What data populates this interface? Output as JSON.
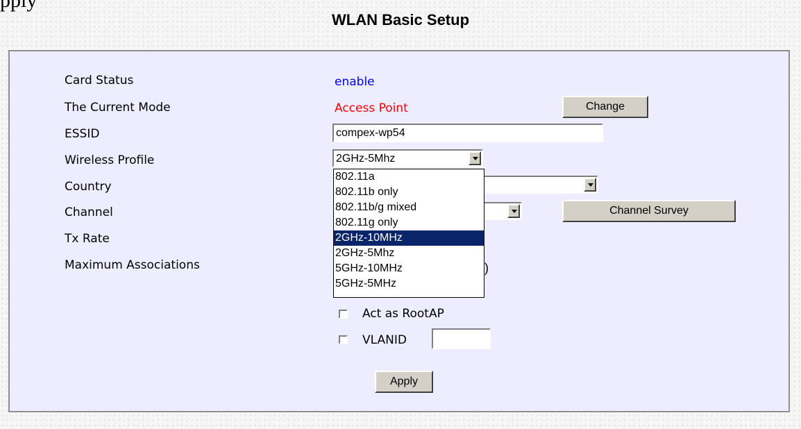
{
  "top_fragment": "pply",
  "page_title": "WLAN Basic Setup",
  "colors": {
    "panel_bg": "#ededff",
    "enable_text": "#0000ff",
    "mode_text": "#ff0000",
    "selected_bg": "#0a246a"
  },
  "fields": {
    "card_status_label": "Card Status",
    "card_status_value": "enable",
    "mode_label": "The Current Mode",
    "mode_value": "Access Point",
    "change_button": "Change",
    "essid_label": "ESSID",
    "essid_value": "compex-wp54",
    "profile_label": "Wireless Profile",
    "profile_value": "2GHz-5Mhz",
    "country_label": "Country",
    "channel_label": "Channel",
    "channel_survey_button": "Channel Survey",
    "tx_rate_label": "Tx Rate",
    "max_assoc_label": "Maximum Associations",
    "max_assoc_fragment": ")"
  },
  "profile_options": [
    {
      "label": "802.11a",
      "selected": false
    },
    {
      "label": "802.11b only",
      "selected": false
    },
    {
      "label": "802.11b/g mixed",
      "selected": false
    },
    {
      "label": "802.11g only",
      "selected": false
    },
    {
      "label": "2GHz-10MHz",
      "selected": true
    },
    {
      "label": "2GHz-5Mhz",
      "selected": false
    },
    {
      "label": "5GHz-10MHz",
      "selected": false
    },
    {
      "label": "5GHz-5MHz",
      "selected": false
    }
  ],
  "checkboxes": {
    "root_ap_label": "Act as RootAP",
    "root_ap_checked": false,
    "vlan_label": "VLANID",
    "vlan_checked": false,
    "vlan_value": ""
  },
  "apply_button": "Apply"
}
